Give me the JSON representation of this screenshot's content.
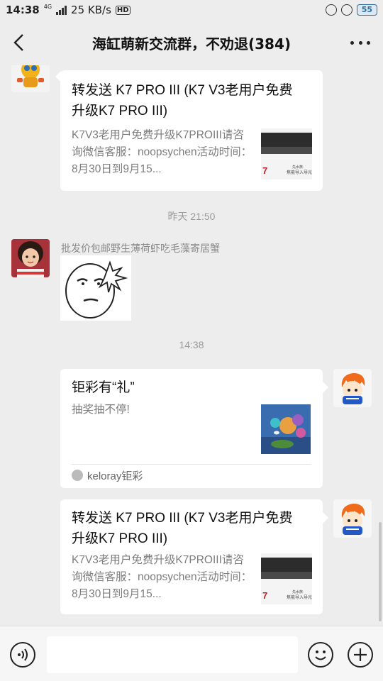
{
  "status_bar": {
    "time": "14:38",
    "network": "4G",
    "speed": "25 KB/s",
    "hd": "HD",
    "battery": "55"
  },
  "header": {
    "title": "海缸萌新交流群，不劝退(384)"
  },
  "messages": [
    {
      "type": "link-card",
      "side": "left",
      "title": "转发送 K7 PRO III (K7 V3老用户免费升级K7 PRO III)",
      "desc": "K7V3老用户免费升级K7PROIII请咨询微信客服：noopsychen活动时间：8月30日到9月15..."
    },
    {
      "type": "time",
      "text": "昨天 21:50"
    },
    {
      "type": "sticker",
      "side": "left",
      "sender": "批发价包邮野生薄荷虾吃毛藻寄居蟹"
    },
    {
      "type": "time",
      "text": "14:38"
    },
    {
      "type": "link-card",
      "side": "right",
      "title": "钜彩有“礼”",
      "desc": "抽奖抽不停!",
      "source": "keloray钜彩"
    },
    {
      "type": "link-card",
      "side": "right",
      "title": "转发送 K7 PRO III (K7 V3老用户免费升级K7 PRO III)",
      "desc": "K7V3老用户免费升级K7PROIII请咨询微信客服：noopsychen活动时间：8月30日到9月15..."
    }
  ],
  "thumb_text": {
    "brand_small": "先水族·",
    "product_caption": "焦能导入导光"
  },
  "input_bar": {
    "placeholder": ""
  },
  "colors": {
    "background": "#ededed",
    "card": "#ffffff",
    "battery": "#2a6f9e"
  },
  "icons": [
    "signal-icon",
    "hd-icon",
    "alarm-icon",
    "lock-icon",
    "back-arrow-icon",
    "more-icon",
    "voice-icon",
    "emoji-icon",
    "plus-icon"
  ]
}
